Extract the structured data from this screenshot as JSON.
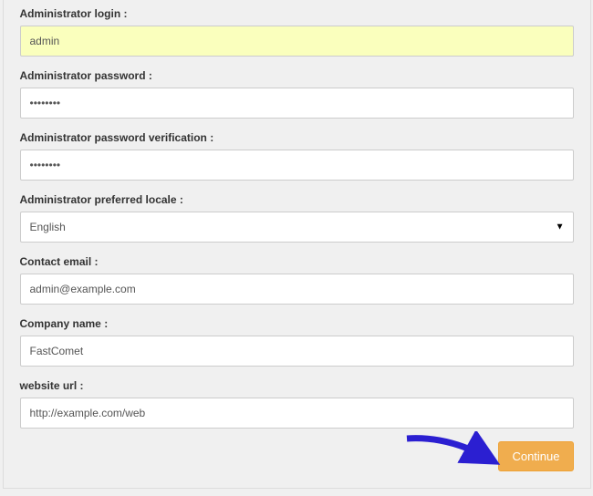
{
  "form": {
    "admin_login": {
      "label": "Administrator login :",
      "value": "admin"
    },
    "admin_password": {
      "label": "Administrator password :",
      "value": "••••••••"
    },
    "admin_password_verify": {
      "label": "Administrator password verification :",
      "value": "••••••••"
    },
    "admin_locale": {
      "label": "Administrator preferred locale :",
      "selected": "English"
    },
    "contact_email": {
      "label": "Contact email :",
      "value": "admin@example.com"
    },
    "company_name": {
      "label": "Company name :",
      "value": "FastComet"
    },
    "website_url": {
      "label": "website url :",
      "value": "http://example.com/web"
    }
  },
  "actions": {
    "continue_label": "Continue"
  },
  "colors": {
    "accent": "#f0ad4e",
    "arrow": "#2b1fd1"
  }
}
